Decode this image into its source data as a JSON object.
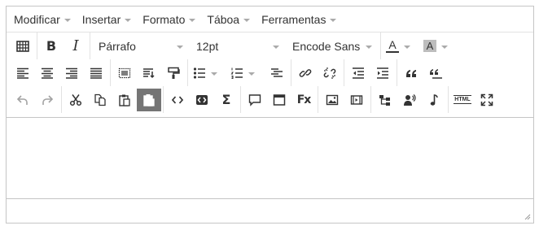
{
  "menubar": {
    "items": [
      {
        "label": "Modificar"
      },
      {
        "label": "Insertar"
      },
      {
        "label": "Formato"
      },
      {
        "label": "Táboa"
      },
      {
        "label": "Ferramentas"
      }
    ]
  },
  "toolbar": {
    "block_format": "Párrafo",
    "font_size": "12pt",
    "font_family": "Encode Sans",
    "text_color_glyph": "A",
    "bg_color_glyph": "A",
    "text_color_accent": "#e03e2d",
    "bg_color_accent": "#bdbdbd",
    "bold_glyph": "B",
    "italic_glyph": "I",
    "sum_glyph": "Σ",
    "fx_glyph": "Fx",
    "html_glyph": "HTML",
    "icons": [
      "grid-icon",
      "bold-icon",
      "italic-icon",
      "text-color-icon",
      "background-color-icon",
      "align-left-icon",
      "align-center-icon",
      "align-right-icon",
      "align-justify-icon",
      "select-all-icon",
      "insert-text-icon",
      "format-painter-icon",
      "bullet-list-icon",
      "numbered-list-icon",
      "indent-level-icon",
      "link-icon",
      "unlink-icon",
      "outdent-icon",
      "indent-icon",
      "blockquote-icon",
      "cite-icon",
      "undo-icon",
      "redo-icon",
      "cut-icon",
      "copy-icon",
      "paste-icon",
      "paste-text-icon",
      "code-icon",
      "code-block-icon",
      "sigma-icon",
      "comment-icon",
      "window-icon",
      "formula-icon",
      "image-icon",
      "media-icon",
      "hierarchy-icon",
      "speech-icon",
      "music-note-icon",
      "html-icon",
      "fullscreen-icon"
    ]
  },
  "colors": {
    "active_button": "#757575",
    "border": "#c5c5c5"
  }
}
